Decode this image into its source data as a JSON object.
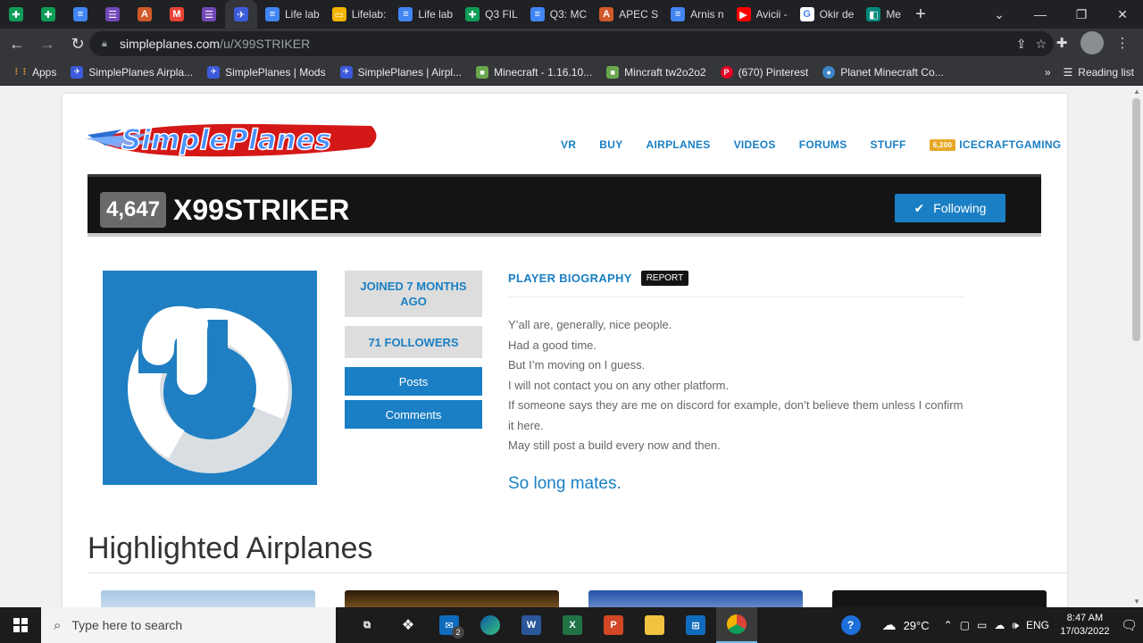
{
  "browser": {
    "tabs": [
      {
        "label": "",
        "icon": "sheets-icon",
        "color": "#0f9d58",
        "pinned": true
      },
      {
        "label": "",
        "icon": "sheets-icon",
        "color": "#0f9d58",
        "pinned": true
      },
      {
        "label": "",
        "icon": "docs-icon",
        "color": "#4285f4",
        "pinned": true
      },
      {
        "label": "",
        "icon": "forms-icon",
        "color": "#7248b9",
        "pinned": true
      },
      {
        "label": "",
        "icon": "apec-icon",
        "color": "#d05a2a",
        "pinned": true
      },
      {
        "label": "",
        "icon": "gmail-icon",
        "color": "#ea4335",
        "pinned": true
      },
      {
        "label": "",
        "icon": "forms-icon",
        "color": "#7248b9",
        "pinned": true
      },
      {
        "label": "",
        "icon": "simpleplanes-icon",
        "color": "#3b5bdb",
        "pinned": true,
        "active": true
      },
      {
        "label": "Life lab",
        "icon": "docs-icon",
        "color": "#4285f4"
      },
      {
        "label": "Lifelab:",
        "icon": "slides-icon",
        "color": "#f4b400"
      },
      {
        "label": "Life lab",
        "icon": "docs-icon",
        "color": "#4285f4"
      },
      {
        "label": "Q3 FIL",
        "icon": "sheets-icon",
        "color": "#0f9d58"
      },
      {
        "label": "Q3: MC",
        "icon": "docs-icon",
        "color": "#4285f4"
      },
      {
        "label": "APEC S",
        "icon": "apec-icon",
        "color": "#d05a2a"
      },
      {
        "label": "Arnis n",
        "icon": "docs-icon",
        "color": "#4285f4"
      },
      {
        "label": "Avicii -",
        "icon": "youtube-icon",
        "color": "#ff0000"
      },
      {
        "label": "Okir de",
        "icon": "google-icon",
        "color": "#ffffff"
      },
      {
        "label": "Me",
        "icon": "meet-icon",
        "color": "#00897b"
      }
    ],
    "url_host": "simpleplanes.com",
    "url_path": "/u/X99STRIKER",
    "bookmarks": [
      {
        "label": "Apps",
        "icon": "apps-grid-icon",
        "color": "#e8eaed"
      },
      {
        "label": "SimplePlanes Airpla...",
        "icon": "simpleplanes-icon",
        "color": "#3b5bdb"
      },
      {
        "label": "SimplePlanes | Mods",
        "icon": "simpleplanes-icon",
        "color": "#3b5bdb"
      },
      {
        "label": "SimplePlanes | Airpl...",
        "icon": "simpleplanes-icon",
        "color": "#3b5bdb"
      },
      {
        "label": "Minecraft - 1.16.10...",
        "icon": "minecraft-icon",
        "color": "#6aa84f"
      },
      {
        "label": "Mincraft tw2o2o2",
        "icon": "minecraft-icon",
        "color": "#6aa84f"
      },
      {
        "label": "(670) Pinterest",
        "icon": "pinterest-icon",
        "color": "#e60023"
      },
      {
        "label": "Planet Minecraft Co...",
        "icon": "globe-icon",
        "color": "#3d85c6"
      }
    ],
    "more_bookmarks": "»",
    "reading_list": "Reading list"
  },
  "site": {
    "nav": [
      "VR",
      "BUY",
      "AIRPLANES",
      "VIDEOS",
      "FORUMS",
      "STUFF"
    ],
    "user_points": "6,200",
    "user_name": "ICECRAFTGAMING",
    "accent": "#1a7fc4"
  },
  "profile": {
    "points": "4,647",
    "username": "X99STRIKER",
    "follow_label": "Following",
    "joined": "JOINED 7 MONTHS AGO",
    "followers": "71 FOLLOWERS",
    "posts_label": "Posts",
    "comments_label": "Comments",
    "bio_title": "PLAYER BIOGRAPHY",
    "report_label": "REPORT",
    "bio_lines": [
      "Y’all are, generally, nice people.",
      "Had a good time.",
      "But I’m moving on I guess.",
      "I will not contact you on any other platform.",
      "If someone says they are me on discord for example, don’t believe them unless I confirm it here.",
      "May still post a build every now and then."
    ],
    "bio_big": "So long mates."
  },
  "highlights": {
    "title": "Highlighted Airplanes"
  },
  "taskbar": {
    "search_placeholder": "Type here to search",
    "mail_badge": "2",
    "temperature": "29°C",
    "language": "ENG",
    "time": "8:47 AM",
    "date": "17/03/2022"
  }
}
